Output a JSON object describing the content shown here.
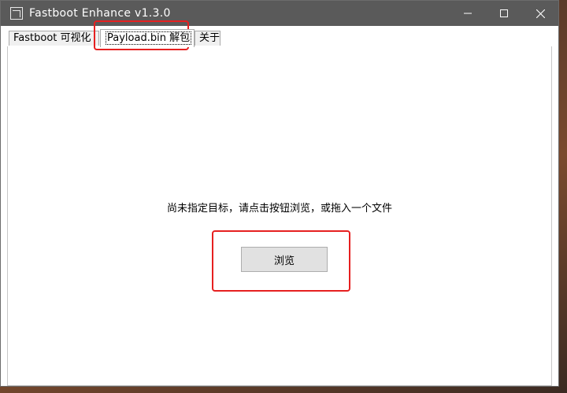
{
  "window": {
    "title": "Fastboot Enhance v1.3.0"
  },
  "tabs": [
    {
      "label": "Fastboot 可视化"
    },
    {
      "label": "Payload.bin 解包"
    },
    {
      "label": "关于"
    }
  ],
  "active_tab": "Payload.bin 解包",
  "panel": {
    "hint": "尚未指定目标，请点击按钮浏览，或拖入一个文件",
    "browse_label": "浏览"
  },
  "annotations": {
    "highlight_color": "#e62020"
  },
  "icons": [
    "app-icon",
    "minimize-icon",
    "maximize-icon",
    "close-icon"
  ]
}
